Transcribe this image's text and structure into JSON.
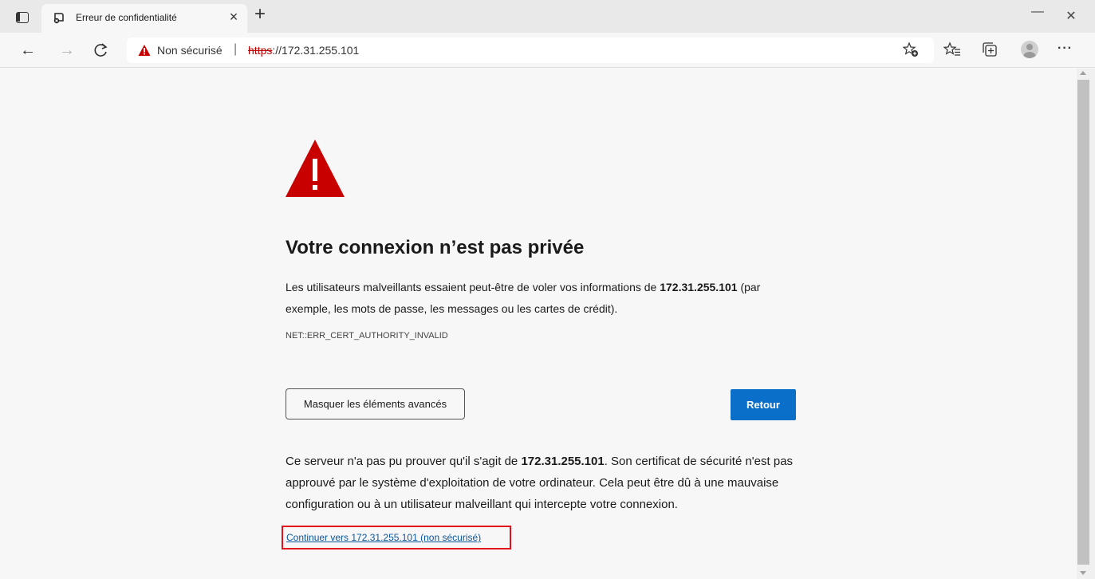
{
  "browser": {
    "tab": {
      "title": "Erreur de confidentialité",
      "close": "×"
    },
    "new_tab": "+",
    "window": {
      "minimize": "—",
      "restore": "▢",
      "close": "✕"
    },
    "nav": {
      "back": "←",
      "forward": "→",
      "reload": "C"
    },
    "address": {
      "security_label": "Non sécurisé",
      "separator": "|",
      "scheme": "https",
      "rest": "://172.31.255.101"
    },
    "more_label": "···"
  },
  "page": {
    "heading": "Votre connexion n’est pas privée",
    "desc_prefix": "Les utilisateurs malveillants essaient peut-être de voler vos informations de ",
    "desc_host": "172.31.255.101",
    "desc_suffix": " (par exemple, les mots de passe, les messages ou les cartes de crédit).",
    "error_code": "NET::ERR_CERT_AUTHORITY_INVALID",
    "advanced_button": "Masquer les éléments avancés",
    "back_button": "Retour",
    "explain_prefix": "Ce serveur n'a pas pu prouver qu'il s'agit de ",
    "explain_host": "172.31.255.101",
    "explain_suffix": ". Son certificat de sécurité n'est pas approuvé par le système d'exploitation de votre ordinateur. Cela peut être dû à une mauvaise configuration ou à un utilisateur malveillant qui intercepte votre connexion.",
    "proceed_link": "Continuer vers 172.31.255.101 (non sécurisé)"
  },
  "colors": {
    "warning_red": "#c80000",
    "primary_button": "#0a6fc9",
    "highlight_box": "#e3101b",
    "link": "#0a57a0"
  }
}
